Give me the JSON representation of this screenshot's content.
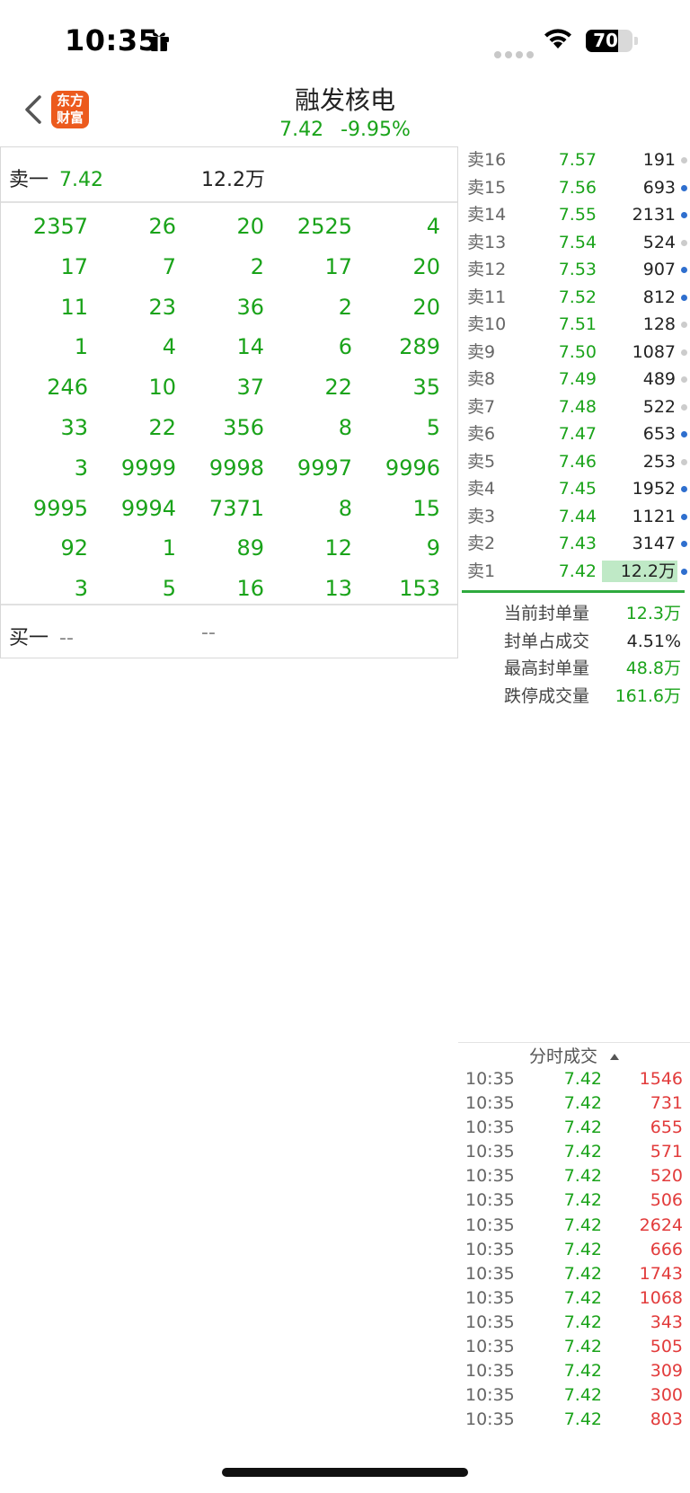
{
  "status": {
    "time": "10:35",
    "battery": "70",
    "battery_level": 0.7
  },
  "header": {
    "logo_line1": "东方",
    "logo_line2": "财富",
    "title": "融发核电",
    "price": "7.42",
    "change": "-9.95%"
  },
  "left": {
    "sell1_label": "卖一",
    "sell1_price": "7.42",
    "sell1_vol": "12.2万",
    "grid": [
      [
        "2357",
        "26",
        "20",
        "2525",
        "4"
      ],
      [
        "17",
        "7",
        "2",
        "17",
        "20"
      ],
      [
        "11",
        "23",
        "36",
        "2",
        "20"
      ],
      [
        "1",
        "4",
        "14",
        "6",
        "289"
      ],
      [
        "246",
        "10",
        "37",
        "22",
        "35"
      ],
      [
        "33",
        "22",
        "356",
        "8",
        "5"
      ],
      [
        "3",
        "9999",
        "9998",
        "9997",
        "9996"
      ],
      [
        "9995",
        "9994",
        "7371",
        "8",
        "15"
      ],
      [
        "92",
        "1",
        "89",
        "12",
        "9"
      ],
      [
        "3",
        "5",
        "16",
        "13",
        "153"
      ]
    ],
    "buy1_label": "买一",
    "buy1_price": "--",
    "buy1_vol": "--"
  },
  "asks": [
    {
      "label": "卖16",
      "price": "7.57",
      "vol": "191",
      "dot": "#cccccc"
    },
    {
      "label": "卖15",
      "price": "7.56",
      "vol": "693",
      "dot": "#2f6fce"
    },
    {
      "label": "卖14",
      "price": "7.55",
      "vol": "2131",
      "dot": "#2f6fce"
    },
    {
      "label": "卖13",
      "price": "7.54",
      "vol": "524",
      "dot": "#cccccc"
    },
    {
      "label": "卖12",
      "price": "7.53",
      "vol": "907",
      "dot": "#2f6fce"
    },
    {
      "label": "卖11",
      "price": "7.52",
      "vol": "812",
      "dot": "#2f6fce"
    },
    {
      "label": "卖10",
      "price": "7.51",
      "vol": "128",
      "dot": "#cccccc"
    },
    {
      "label": "卖9",
      "price": "7.50",
      "vol": "1087",
      "dot": "#cccccc"
    },
    {
      "label": "卖8",
      "price": "7.49",
      "vol": "489",
      "dot": "#cccccc"
    },
    {
      "label": "卖7",
      "price": "7.48",
      "vol": "522",
      "dot": "#cccccc"
    },
    {
      "label": "卖6",
      "price": "7.47",
      "vol": "653",
      "dot": "#2f6fce"
    },
    {
      "label": "卖5",
      "price": "7.46",
      "vol": "253",
      "dot": "#cccccc"
    },
    {
      "label": "卖4",
      "price": "7.45",
      "vol": "1952",
      "dot": "#2f6fce"
    },
    {
      "label": "卖3",
      "price": "7.44",
      "vol": "1121",
      "dot": "#2f6fce"
    },
    {
      "label": "卖2",
      "price": "7.43",
      "vol": "3147",
      "dot": "#2f6fce"
    },
    {
      "label": "卖1",
      "price": "7.42",
      "vol": "12.2万",
      "dot": "#2f6fce",
      "highlight": true
    }
  ],
  "stats": [
    {
      "label": "当前封单量",
      "value": "12.3万",
      "color": "#1aa31a"
    },
    {
      "label": "封单占成交",
      "value": "4.51%",
      "color": "#222222"
    },
    {
      "label": "最高封单量",
      "value": "48.8万",
      "color": "#1aa31a"
    },
    {
      "label": "跌停成交量",
      "value": "161.6万",
      "color": "#1aa31a"
    }
  ],
  "trades_header": "分时成交",
  "trades": [
    {
      "time": "10:35",
      "price": "7.42",
      "vol": "1546"
    },
    {
      "time": "10:35",
      "price": "7.42",
      "vol": "731"
    },
    {
      "time": "10:35",
      "price": "7.42",
      "vol": "655"
    },
    {
      "time": "10:35",
      "price": "7.42",
      "vol": "571"
    },
    {
      "time": "10:35",
      "price": "7.42",
      "vol": "520"
    },
    {
      "time": "10:35",
      "price": "7.42",
      "vol": "506"
    },
    {
      "time": "10:35",
      "price": "7.42",
      "vol": "2624"
    },
    {
      "time": "10:35",
      "price": "7.42",
      "vol": "666"
    },
    {
      "time": "10:35",
      "price": "7.42",
      "vol": "1743"
    },
    {
      "time": "10:35",
      "price": "7.42",
      "vol": "1068"
    },
    {
      "time": "10:35",
      "price": "7.42",
      "vol": "343"
    },
    {
      "time": "10:35",
      "price": "7.42",
      "vol": "505"
    },
    {
      "time": "10:35",
      "price": "7.42",
      "vol": "309"
    },
    {
      "time": "10:35",
      "price": "7.42",
      "vol": "300"
    },
    {
      "time": "10:35",
      "price": "7.42",
      "vol": "803"
    }
  ],
  "colors": {
    "up_green": "#1aa31a",
    "trade_red": "#e23b3b",
    "brand": "#ec5a1d"
  }
}
